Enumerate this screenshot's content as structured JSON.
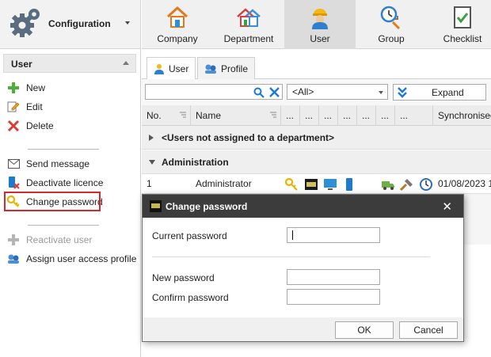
{
  "app": {
    "module_title": "Configuration",
    "toolbar": [
      {
        "label": "Company",
        "icon": "company-icon"
      },
      {
        "label": "Department",
        "icon": "department-icon"
      },
      {
        "label": "User",
        "icon": "user-icon"
      },
      {
        "label": "Group",
        "icon": "group-icon"
      },
      {
        "label": "Checklist",
        "icon": "checklist-icon"
      }
    ]
  },
  "sidebar": {
    "section_title": "User",
    "items": [
      {
        "label": "New",
        "icon": "plus-icon"
      },
      {
        "label": "Edit",
        "icon": "edit-icon"
      },
      {
        "label": "Delete",
        "icon": "delete-icon"
      },
      {
        "label": "Send message",
        "icon": "mail-icon"
      },
      {
        "label": "Deactivate licence",
        "icon": "deactivate-icon"
      },
      {
        "label": "Change password",
        "icon": "key-icon"
      },
      {
        "label": "Reactivate user",
        "icon": "plus-icon"
      },
      {
        "label": "Assign user access profile",
        "icon": "profile-icon"
      }
    ]
  },
  "main": {
    "tabs": [
      {
        "label": "User",
        "icon": "user-icon"
      },
      {
        "label": "Profile",
        "icon": "profile-icon"
      }
    ],
    "search": {
      "value": "",
      "placeholder": ""
    },
    "filter_combo": {
      "value": "<All>"
    },
    "expand_label": "Expand",
    "grid": {
      "columns": [
        "No.",
        "Name",
        "...",
        "...",
        "...",
        "...",
        "...",
        "...",
        "...",
        "Synchronised"
      ],
      "groups": [
        {
          "label": "<Users not assigned to a department>"
        },
        {
          "label": "Administration"
        }
      ],
      "rows": [
        {
          "no": "1",
          "name": "Administrator",
          "synchronised": "01/08/2023 1"
        }
      ]
    }
  },
  "dialog": {
    "title": "Change password",
    "close_glyph": "✕",
    "fields": [
      {
        "label": "Current password",
        "value": ""
      },
      {
        "label": "New password",
        "value": ""
      },
      {
        "label": "Confirm password",
        "value": ""
      }
    ],
    "ok_label": "OK",
    "cancel_label": "Cancel"
  },
  "colors": {
    "highlight": "#d6282f",
    "dialog_title_bg": "#3c3c3c",
    "accent_blue": "#1a7ad4"
  }
}
